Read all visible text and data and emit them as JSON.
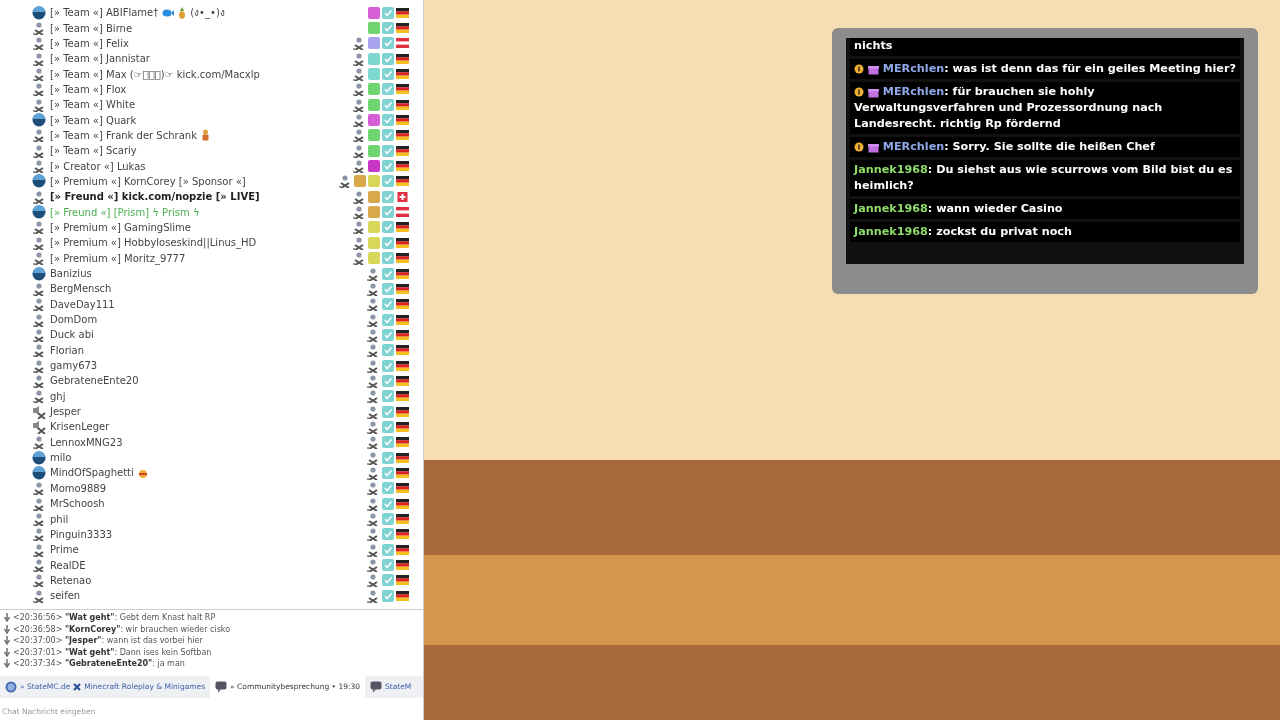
{
  "clients": [
    {
      "name": "[» Team «] ABIFlame† ",
      "avatar": {
        "kind": "ball"
      },
      "name_icons": [
        {
          "kind": "fish"
        },
        {
          "kind": "pineapple"
        }
      ],
      "name_suffix": " (ง•_•)ง",
      "talk_icon": false,
      "badges": [
        {
          "color": "#d65fd6"
        }
      ],
      "flag": {
        "kind": "de"
      }
    },
    {
      "name": "[» Team «] Birne",
      "avatar": {
        "kind": "person"
      },
      "talk_icon": false,
      "badges": [
        {
          "color": "#6fd66f"
        }
      ],
      "flag": {
        "kind": "de"
      }
    },
    {
      "name": "[» Team «] Felix",
      "avatar": {
        "kind": "person"
      },
      "talk_icon": true,
      "badges": [
        {
          "color": "#a9a3f0"
        }
      ],
      "flag": {
        "kind": "at"
      }
    },
    {
      "name": "[» Team «] Jannistar",
      "avatar": {
        "kind": "person"
      },
      "talk_icon": true,
      "badges": [
        {
          "color": "#7fd8cf"
        }
      ],
      "flag": {
        "kind": "de"
      }
    },
    {
      "name": "[» Team «] Max (☞ﾟヮﾟ)☞ kick.com/Macxlp",
      "avatar": {
        "kind": "person"
      },
      "talk_icon": true,
      "badges": [
        {
          "color": "#7fd8cf"
        }
      ],
      "flag": {
        "kind": "de"
      }
    },
    {
      "name": "[» Team «] Flox",
      "avatar": {
        "kind": "person"
      },
      "talk_icon": true,
      "badges": [
        {
          "color": "#6fd66f"
        }
      ],
      "flag": {
        "kind": "de"
      }
    },
    {
      "name": "[» Team «] White",
      "avatar": {
        "kind": "person"
      },
      "talk_icon": true,
      "badges": [
        {
          "color": "#6fd66f"
        }
      ],
      "flag": {
        "kind": "de"
      }
    },
    {
      "name": "[» Team «] Quark",
      "avatar": {
        "kind": "ball"
      },
      "talk_icon": true,
      "badges": [
        {
          "color": "#d65fd6"
        }
      ],
      "flag": {
        "kind": "de"
      }
    },
    {
      "name": "[» Team «] Frank der Schrank",
      "avatar": {
        "kind": "person"
      },
      "name_icons": [
        {
          "kind": "figure"
        }
      ],
      "talk_icon": true,
      "badges": [
        {
          "color": "#6fd66f"
        }
      ],
      "flag": {
        "kind": "de"
      }
    },
    {
      "name": "[» Team «] Scariy",
      "avatar": {
        "kind": "person"
      },
      "talk_icon": true,
      "badges": [
        {
          "color": "#6fd66f"
        }
      ],
      "flag": {
        "kind": "de"
      }
    },
    {
      "name": "[» Creator «] Lukas",
      "avatar": {
        "kind": "person"
      },
      "talk_icon": true,
      "badges": [
        {
          "color": "#c837c8"
        }
      ],
      "flag": {
        "kind": "de"
      }
    },
    {
      "name": "[» Premium «] KornCorey [» Sponsor «]",
      "avatar": {
        "kind": "ball"
      },
      "talk_icon": true,
      "badges": [
        {
          "color": "#d9a84a"
        },
        {
          "color": "#d7d75a"
        }
      ],
      "flag": {
        "kind": "de"
      }
    },
    {
      "name": "[» Freund «] kick.com/nopzie [» LIVE]",
      "avatar": {
        "kind": "person"
      },
      "bold": true,
      "talk_icon": true,
      "badges": [
        {
          "color": "#d9a84a"
        }
      ],
      "flag": {
        "kind": "ch"
      }
    },
    {
      "name": "[» Freund «] [Prism] ϟ Prism ϟ",
      "avatar": {
        "kind": "ball"
      },
      "color": "#4caf50",
      "talk_icon": true,
      "badges": [
        {
          "color": "#d9a84a"
        }
      ],
      "flag": {
        "kind": "at"
      }
    },
    {
      "name": "[» Premium «] GamingSlime",
      "avatar": {
        "kind": "person"
      },
      "talk_icon": true,
      "badges": [
        {
          "color": "#d7d75a"
        }
      ],
      "flag": {
        "kind": "de"
      }
    },
    {
      "name": "[» Premium «] Hobbyloseskind||Linus_HD",
      "avatar": {
        "kind": "person"
      },
      "talk_icon": true,
      "badges": [
        {
          "color": "#d7d75a"
        }
      ],
      "flag": {
        "kind": "de"
      }
    },
    {
      "name": "[» Premium «] Moritz_9777",
      "avatar": {
        "kind": "person"
      },
      "talk_icon": true,
      "badges": [
        {
          "color": "#d7d75a"
        }
      ],
      "flag": {
        "kind": "de"
      }
    },
    {
      "name": "Banizius",
      "avatar": {
        "kind": "ball"
      },
      "talk_icon": true,
      "flag": {
        "kind": "de"
      }
    },
    {
      "name": "BergMensch",
      "avatar": {
        "kind": "person"
      },
      "talk_icon": true,
      "flag": {
        "kind": "de"
      }
    },
    {
      "name": "DaveDay111",
      "avatar": {
        "kind": "person"
      },
      "talk_icon": true,
      "flag": {
        "kind": "de"
      }
    },
    {
      "name": "DomDom",
      "avatar": {
        "kind": "person"
      },
      "talk_icon": true,
      "flag": {
        "kind": "de"
      }
    },
    {
      "name": "Duck abi",
      "avatar": {
        "kind": "person"
      },
      "talk_icon": true,
      "flag": {
        "kind": "de"
      }
    },
    {
      "name": "Florian",
      "avatar": {
        "kind": "person"
      },
      "talk_icon": true,
      "flag": {
        "kind": "de"
      }
    },
    {
      "name": "gamy673",
      "avatar": {
        "kind": "person"
      },
      "talk_icon": true,
      "flag": {
        "kind": "de"
      }
    },
    {
      "name": "GebrateneEnte20",
      "avatar": {
        "kind": "person"
      },
      "talk_icon": true,
      "flag": {
        "kind": "de"
      }
    },
    {
      "name": "ghj",
      "avatar": {
        "kind": "person"
      },
      "talk_icon": true,
      "flag": {
        "kind": "de"
      }
    },
    {
      "name": "Jesper",
      "avatar": {
        "kind": "muted"
      },
      "talk_icon": true,
      "flag": {
        "kind": "de"
      }
    },
    {
      "name": "KrisenLeger",
      "avatar": {
        "kind": "muted"
      },
      "talk_icon": true,
      "flag": {
        "kind": "de"
      }
    },
    {
      "name": "LennoxMNG23",
      "avatar": {
        "kind": "person"
      },
      "talk_icon": true,
      "flag": {
        "kind": "de"
      }
    },
    {
      "name": "milo",
      "avatar": {
        "kind": "ball"
      },
      "talk_icon": true,
      "flag": {
        "kind": "de"
      }
    },
    {
      "name": "MindOfSpaghetti",
      "avatar": {
        "kind": "ball"
      },
      "name_icons": [
        {
          "kind": "food"
        }
      ],
      "talk_icon": true,
      "flag": {
        "kind": "de"
      }
    },
    {
      "name": "Momo9889",
      "avatar": {
        "kind": "person"
      },
      "talk_icon": true,
      "flag": {
        "kind": "de"
      }
    },
    {
      "name": "MrSchoosh",
      "avatar": {
        "kind": "person"
      },
      "talk_icon": true,
      "flag": {
        "kind": "de"
      }
    },
    {
      "name": "phil",
      "avatar": {
        "kind": "person"
      },
      "talk_icon": true,
      "flag": {
        "kind": "de"
      }
    },
    {
      "name": "Pinguin3333",
      "avatar": {
        "kind": "person"
      },
      "talk_icon": true,
      "flag": {
        "kind": "de"
      }
    },
    {
      "name": "Prime",
      "avatar": {
        "kind": "person"
      },
      "talk_icon": true,
      "flag": {
        "kind": "de"
      }
    },
    {
      "name": "RealDE",
      "avatar": {
        "kind": "person"
      },
      "talk_icon": true,
      "flag": {
        "kind": "de"
      }
    },
    {
      "name": "Retenao",
      "avatar": {
        "kind": "person"
      },
      "talk_icon": true,
      "flag": {
        "kind": "de"
      }
    },
    {
      "name": "seifen",
      "avatar": {
        "kind": "person"
      },
      "talk_icon": true,
      "flag": {
        "kind": "de"
      }
    }
  ],
  "chat_log": [
    {
      "time": "<20:36:56>",
      "user": "\"Wat geht\"",
      "text": ": Gebt dem Knast halt RP"
    },
    {
      "time": "<20:36:58>",
      "user": "\"KornCorey\"",
      "text": ": wir brauchen wieder cisko"
    },
    {
      "time": "<20:37:00>",
      "user": "\"Jesper\"",
      "text": ": wann ist das vorbei hier"
    },
    {
      "time": "<20:37:01>",
      "user": "\"Wat geht\"",
      "text": ": Dann ises kein Softban"
    },
    {
      "time": "<20:37:34>",
      "user": "\"GebrateneEnte20\"",
      "text": ": ja man"
    }
  ],
  "server_tabs": [
    {
      "kind": "server",
      "label": "» StateMC.de",
      "label_2": "Minecraft Roleplay & Minigames",
      "selected": false
    },
    {
      "kind": "channel",
      "label": "» Communitybesprechung • 19:30",
      "selected": true
    },
    {
      "kind": "channel",
      "label": "StateM",
      "selected": false
    }
  ],
  "chat_input": {
    "placeholder": "Chat Nachricht eingeben"
  },
  "stream_chat": [
    {
      "text": "nichts"
    },
    {
      "badges": true,
      "user": "MERchlen",
      "color": "#8fa8e8",
      "text": ": was ist denn das für ein geiles Meeting hier?"
    },
    {
      "badges": true,
      "user": "MERchlen",
      "color": "#8fa8e8",
      "text": ": für brauchen sie hohly Verwaltungsverfahren und Prozessordnung nach Landesrecht. richtig Rp fördernd"
    },
    {
      "badges": true,
      "user": "MERchlen",
      "color": "#8fa8e8",
      "text": ": Sorry. Sie sollte die heißen Chef"
    },
    {
      "badges": false,
      "user": "Jannek1968",
      "color": "#8fdc6a",
      "text": ": Du siehst aus wie scurrows vom Bild bist du es heimlich?"
    },
    {
      "badges": false,
      "user": "Jannek1968",
      "color": "#8fdc6a",
      "text": ": wann wieder Casino"
    },
    {
      "badges": false,
      "user": "Jannek1968",
      "color": "#8fdc6a",
      "text": ": zockst du privat noch"
    }
  ]
}
